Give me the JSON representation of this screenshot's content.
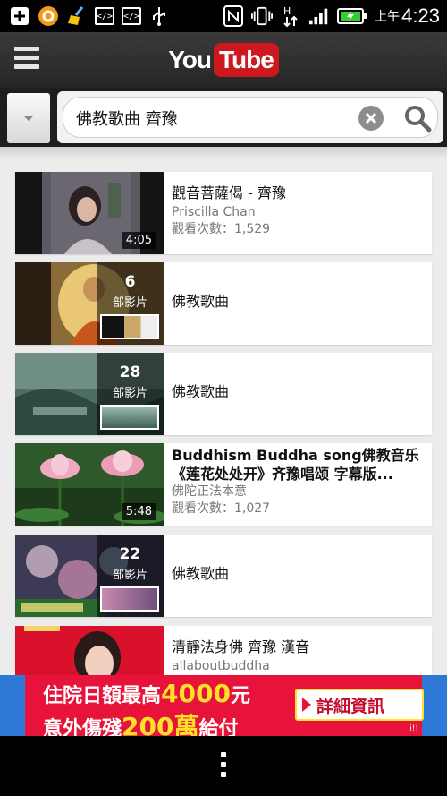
{
  "status_bar": {
    "time_prefix": "上午",
    "time": "4:23",
    "usb_box_label": "</>",
    "icons": [
      "add-icon",
      "app-icon",
      "broom-icon",
      "code-icon",
      "code-icon",
      "usb-icon",
      "nfc-icon",
      "vibrate-icon",
      "data-transfer-icon",
      "signal-icon",
      "battery-charging-icon"
    ]
  },
  "header": {
    "logo_you": "You",
    "logo_tube": "Tube"
  },
  "search": {
    "query": "佛教歌曲 齊豫"
  },
  "results": [
    {
      "title": "觀音菩薩偈 - 齊豫",
      "channel": "Priscilla Chan",
      "views": "觀看次數：1,529",
      "duration": "4:05"
    },
    {
      "title": "佛教歌曲",
      "playlist_count": "6",
      "playlist_label": "部影片"
    },
    {
      "title": "佛教歌曲",
      "playlist_count": "28",
      "playlist_label": "部影片"
    },
    {
      "title": "Buddhism Buddha song佛教音乐《莲花处处开》齐豫唱颂 字幕版...",
      "channel": "佛陀正法本意",
      "views": "觀看次數：1,027",
      "duration": "5:48"
    },
    {
      "title": "佛教歌曲",
      "playlist_count": "22",
      "playlist_label": "部影片"
    },
    {
      "title": "清靜法身佛 齊豫 漢音",
      "channel": "allaboutbuddha"
    }
  ],
  "ad": {
    "line1_a": "住院日額最高",
    "line1_big": "4000",
    "line1_b": "元",
    "line2_a": "意外傷殘",
    "line2_big": "200萬",
    "line2_b": "給付",
    "cta": "詳細資訊",
    "badge": "i!!"
  },
  "colors": {
    "brand_red": "#cc181e",
    "ad_red": "#e8133a",
    "ad_blue": "#2f79d6",
    "ad_yellow": "#ffe12a"
  }
}
